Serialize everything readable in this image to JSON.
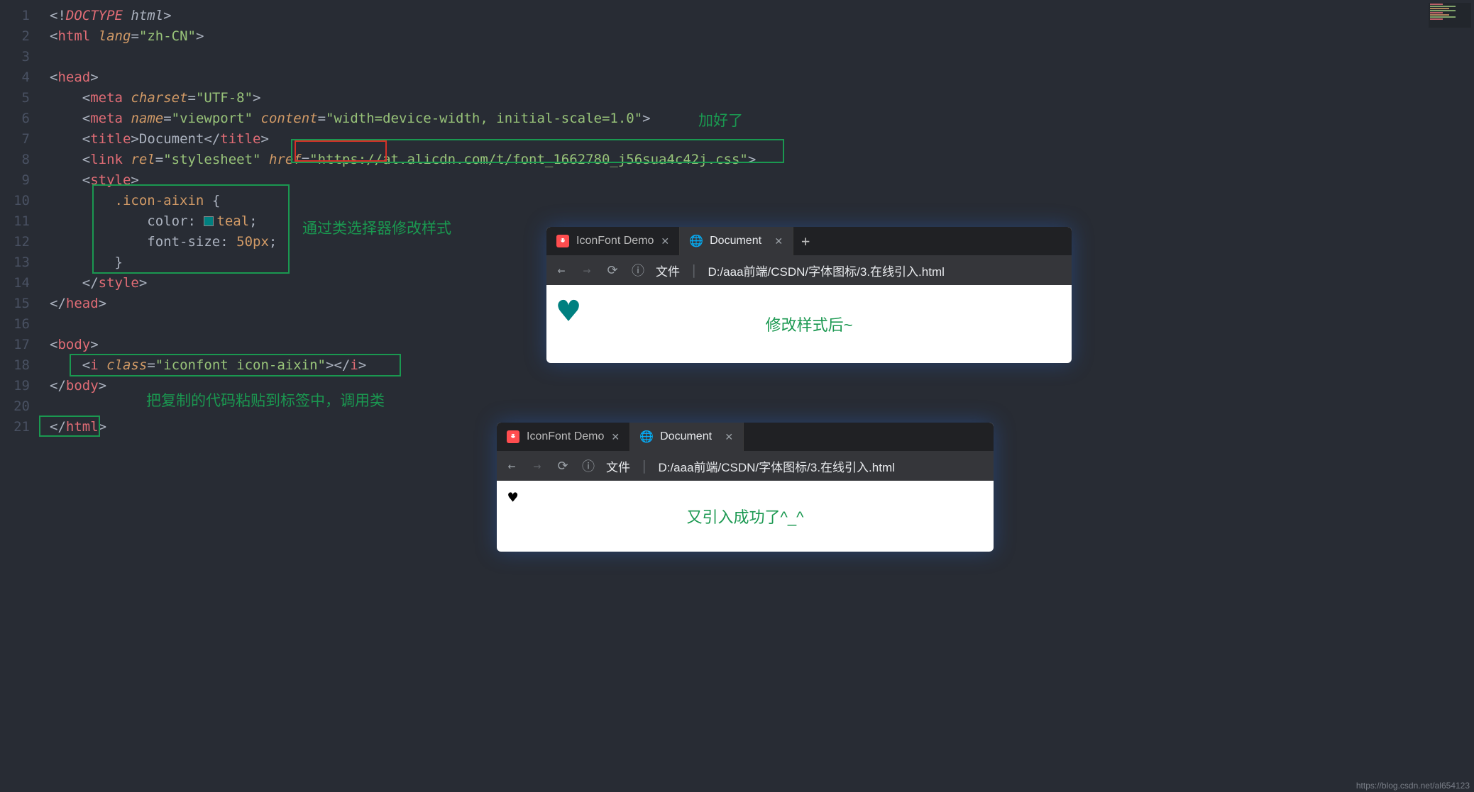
{
  "lineNumbers": [
    "1",
    "2",
    "3",
    "4",
    "5",
    "6",
    "7",
    "8",
    "9",
    "10",
    "11",
    "12",
    "13",
    "14",
    "15",
    "16",
    "17",
    "18",
    "19",
    "20",
    "21"
  ],
  "code": {
    "doctype": "<!DOCTYPE html>",
    "htmlOpen": {
      "tag": "html",
      "attr": "lang",
      "val": "\"zh-CN\""
    },
    "headOpen": "head",
    "metaCharset": {
      "tag": "meta",
      "attr": "charset",
      "val": "\"UTF-8\""
    },
    "metaViewport": {
      "tag": "meta",
      "attr1": "name",
      "val1": "\"viewport\"",
      "attr2": "content",
      "val2": "\"width=device-width, initial-scale=1.0\""
    },
    "titleTag": "title",
    "titleText": "Document",
    "link": {
      "tag": "link",
      "attr1": "rel",
      "val1": "\"stylesheet\"",
      "attr2": "href",
      "val2": "\"https://at.alicdn.com/t/font_1662780_j56sua4c42j.css\""
    },
    "styleTag": "style",
    "cssSelector": ".icon-aixin",
    "cssProp1": "color",
    "cssVal1": "teal",
    "cssProp2": "font-size",
    "cssVal2": "50px",
    "headClose": "head",
    "bodyTag": "body",
    "iTag": {
      "tag": "i",
      "attr": "class",
      "val": "\"iconfont icon-aixin\""
    },
    "htmlClose": "html"
  },
  "annotations": {
    "a1": "加好了",
    "a2": "通过类选择器修改样式",
    "a3": "把复制的代码粘贴到标签中，调用类"
  },
  "browser1": {
    "tab1": "IconFont Demo",
    "tab2": "Document",
    "urlLabel": "文件",
    "urlPath": "D:/aaa前端/CSDN/字体图标/3.在线引入.html",
    "caption": "修改样式后~"
  },
  "browser2": {
    "tab1": "IconFont Demo",
    "tab2": "Document",
    "urlLabel": "文件",
    "urlPath": "D:/aaa前端/CSDN/字体图标/3.在线引入.html",
    "caption": "又引入成功了^_^"
  },
  "watermark": "https://blog.csdn.net/al654123"
}
